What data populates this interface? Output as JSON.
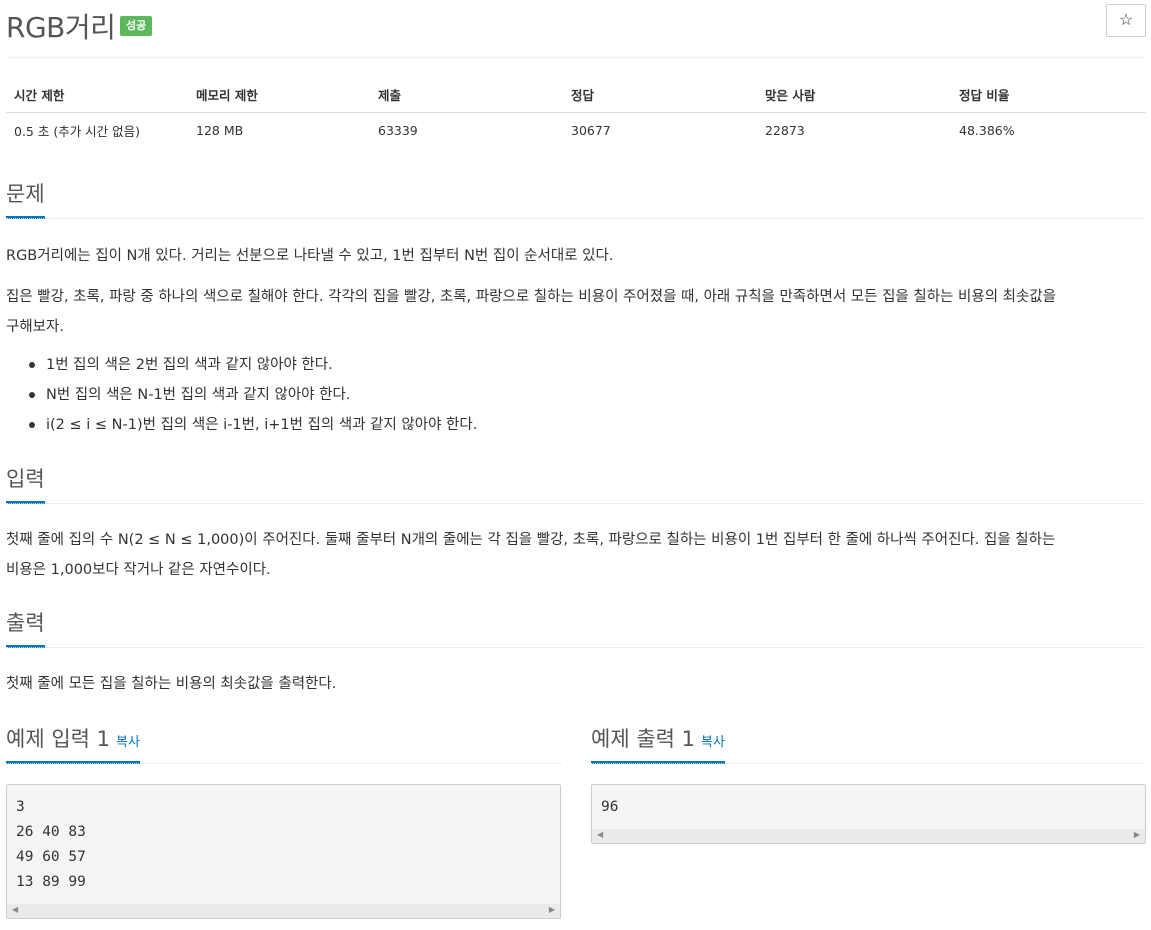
{
  "problem": {
    "title": "RGB거리",
    "badge": "성공",
    "star_icon": "☆"
  },
  "info": {
    "headers": [
      "시간 제한",
      "메모리 제한",
      "제출",
      "정답",
      "맞은 사람",
      "정답 비율"
    ],
    "values": [
      "0.5 초 (추가 시간 없음)",
      "128 MB",
      "63339",
      "30677",
      "22873",
      "48.386%"
    ]
  },
  "sections": {
    "problem": {
      "heading": "문제",
      "para1": "RGB거리에는 집이 N개 있다. 거리는 선분으로 나타낼 수 있고, 1번 집부터 N번 집이 순서대로 있다.",
      "para2_line1": "집은 빨강, 초록, 파랑 중 하나의 색으로 칠해야 한다. 각각의 집을 빨강, 초록, 파랑으로 칠하는 비용이 주어졌을 때, 아래 규칙을 만족하면서 모든 집을 칠하는 비용의 최솟값을",
      "para2_line2": "구해보자.",
      "rules": [
        "1번 집의 색은 2번 집의 색과 같지 않아야 한다.",
        "N번 집의 색은 N-1번 집의 색과 같지 않아야 한다.",
        "i(2 ≤ i ≤ N-1)번 집의 색은 i-1번, i+1번 집의 색과 같지 않아야 한다."
      ]
    },
    "input": {
      "heading": "입력",
      "line1": "첫째 줄에 집의 수 N(2 ≤ N ≤ 1,000)이 주어진다. 둘째 줄부터 N개의 줄에는 각 집을 빨강, 초록, 파랑으로 칠하는 비용이 1번 집부터 한 줄에 하나씩 주어진다. 집을 칠하는",
      "line2": "비용은 1,000보다 작거나 같은 자연수이다."
    },
    "output": {
      "heading": "출력",
      "text": "첫째 줄에 모든 집을 칠하는 비용의 최솟값을 출력한다."
    }
  },
  "samples": {
    "input": {
      "heading": "예제 입력 1",
      "copy": "복사",
      "content": "3\n26 40 83\n49 60 57\n13 89 99"
    },
    "output": {
      "heading": "예제 출력 1",
      "copy": "복사",
      "content": "96"
    }
  },
  "colors": {
    "accent": "#0076c0",
    "badge_success": "#5cb85c"
  }
}
